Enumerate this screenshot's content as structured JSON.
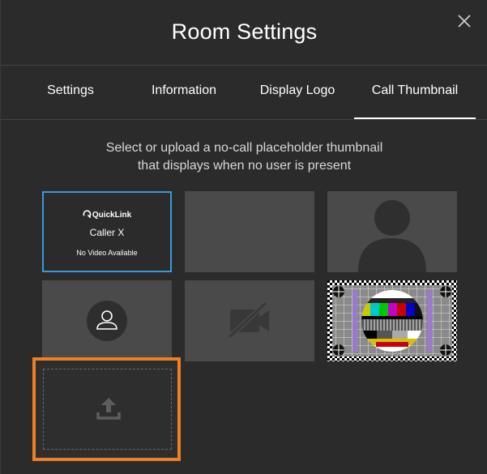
{
  "dialog": {
    "title": "Room Settings",
    "close_icon": "close-icon"
  },
  "tabs": [
    {
      "label": "Settings",
      "active": false
    },
    {
      "label": "Information",
      "active": false
    },
    {
      "label": "Display Logo",
      "active": false
    },
    {
      "label": "Call Thumbnail",
      "active": true
    }
  ],
  "description": {
    "line1": "Select or upload a no-call placeholder thumbnail",
    "line2": "that displays when no user is present"
  },
  "thumbnails": {
    "quicklink": {
      "logo_text": "QuickLink",
      "caller": "Caller X",
      "status": "No Video Available",
      "selected": true
    },
    "items": [
      "quicklink-card",
      "blank-gray",
      "person-silhouette",
      "user-circle-icon",
      "video-off-icon",
      "test-card"
    ]
  },
  "colors": {
    "background": "#2b2b2b",
    "thumbnail": "#4a4a4a",
    "selected_border": "#3a9ad9",
    "highlight_border": "#f07f23"
  },
  "upload": {
    "icon": "upload-icon"
  }
}
